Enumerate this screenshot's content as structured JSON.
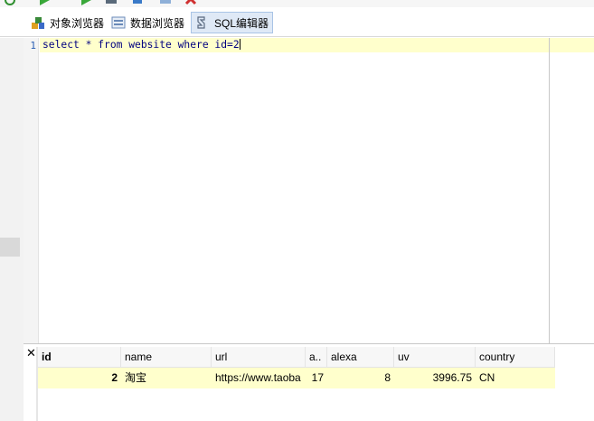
{
  "toolbar": {
    "icons": [
      "refresh-icon",
      "run-icon",
      "run-line-icon",
      "step-icon",
      "pin-icon",
      "new-icon",
      "delete-icon"
    ]
  },
  "tabs": [
    {
      "label": "对象浏览器",
      "icon": "object-browser-icon"
    },
    {
      "label": "数据浏览器",
      "icon": "data-browser-icon"
    },
    {
      "label": "SQL编辑器",
      "icon": "sql-editor-icon"
    }
  ],
  "editor": {
    "line_number": "1",
    "code": "select * from website where id=2"
  },
  "results": {
    "columns": [
      "id",
      "name",
      "url",
      "a..",
      "alexa",
      "uv",
      "country"
    ],
    "rows": [
      [
        "2",
        "淘宝",
        "https://www.taoba",
        "17",
        "8",
        "3996.75",
        "CN"
      ]
    ]
  },
  "colors": {
    "current_line": "#ffffcc",
    "active_tab": "#dfe9f6",
    "line_number": "#2b5fb3"
  }
}
